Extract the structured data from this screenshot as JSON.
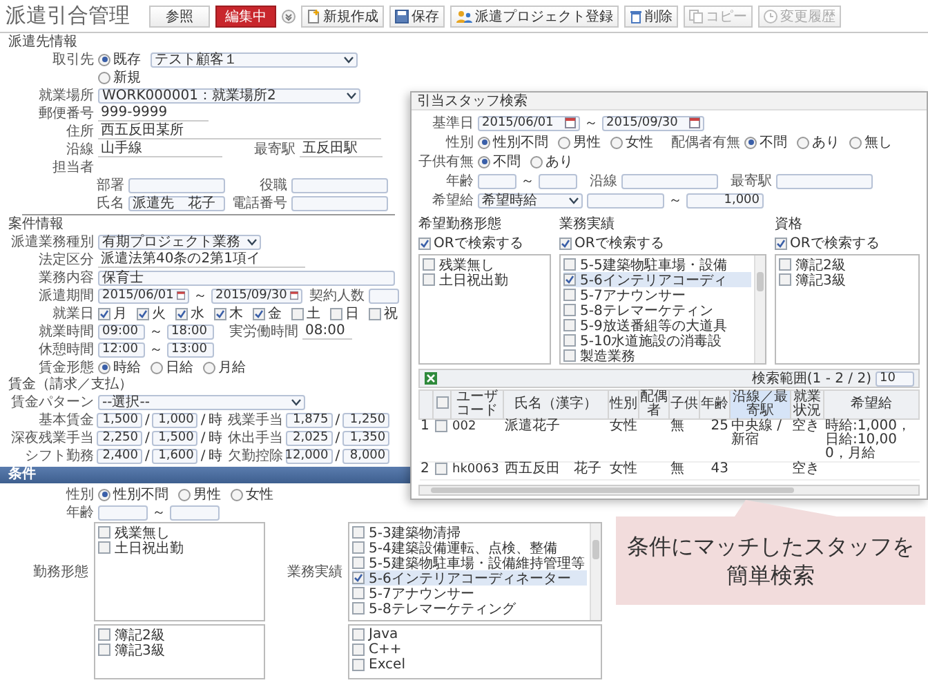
{
  "app_title": "派遣引合管理",
  "mode_tabs": [
    {
      "label": "参照",
      "selected": false
    },
    {
      "label": "編集中",
      "selected": true
    }
  ],
  "toolbar": [
    {
      "label": "新規作成",
      "kind": "new",
      "disabled": false
    },
    {
      "label": "保存",
      "kind": "save",
      "disabled": false
    },
    {
      "label": "派遣プロジェクト登録",
      "kind": "project",
      "disabled": false
    },
    {
      "label": "削除",
      "kind": "delete",
      "disabled": false
    },
    {
      "label": "コピー",
      "kind": "copy",
      "disabled": true
    },
    {
      "label": "変更履歴",
      "kind": "history",
      "disabled": true
    }
  ],
  "client_info": {
    "title": "派遣先情報",
    "client": {
      "label": "取引先",
      "options": [
        {
          "label": "既存",
          "selected": true
        },
        {
          "label": "新規",
          "selected": false
        }
      ],
      "value": "テスト顧客１"
    },
    "workplace": {
      "label": "就業場所",
      "value": "WORK000001：就業場所2"
    },
    "postal_code": {
      "label": "郵便番号",
      "value": "999-9999"
    },
    "address": {
      "label": "住所",
      "value": "西五反田某所"
    },
    "line": {
      "label": "沿線",
      "value": "山手線"
    },
    "station": {
      "label": "最寄駅",
      "value": "五反田駅"
    },
    "contact": {
      "label": "担当者",
      "department": {
        "label": "部署"
      },
      "position": {
        "label": "役職"
      },
      "name": {
        "label": "氏名",
        "value": "派遣先　花子"
      },
      "phone": {
        "label": "電話番号"
      }
    }
  },
  "project_info": {
    "title": "案件情報",
    "work_type": {
      "label": "派遣業務種別",
      "value": "有期プロジェクト業務"
    },
    "legal_category": {
      "label": "法定区分",
      "value": "派遣法第40条の2第1項イ"
    },
    "description": {
      "label": "業務内容",
      "value": "保育士"
    },
    "period": {
      "label": "派遣期間",
      "from": "2015/06/01",
      "tilde": "～",
      "to": "2015/09/30"
    },
    "headcount": {
      "label": "契約人数"
    },
    "workdays": {
      "label": "就業日",
      "days": [
        {
          "label": "月",
          "checked": true
        },
        {
          "label": "火",
          "checked": true
        },
        {
          "label": "水",
          "checked": true
        },
        {
          "label": "木",
          "checked": true
        },
        {
          "label": "金",
          "checked": true
        },
        {
          "label": "土",
          "checked": false
        },
        {
          "label": "日",
          "checked": false
        },
        {
          "label": "祝",
          "checked": false
        }
      ]
    },
    "work_hours": {
      "label": "就業時間",
      "from": "09:00",
      "tilde": "～",
      "to": "18:00"
    },
    "actual_hours": {
      "label": "実労働時間",
      "value": "08:00"
    },
    "break_hours": {
      "label": "休憩時間",
      "from": "12:00",
      "tilde": "～",
      "to": "13:00"
    },
    "wage_type": {
      "label": "賃金形態",
      "options": [
        {
          "label": "時給",
          "selected": true
        },
        {
          "label": "日給",
          "selected": false
        },
        {
          "label": "月給",
          "selected": false
        }
      ]
    }
  },
  "wages": {
    "title": "賃金（請求／支払）",
    "pattern": {
      "label": "賃金パターン",
      "value": "--選択--"
    },
    "rows": [
      {
        "label": "基本賃金",
        "bill": "1,500",
        "slash": "/",
        "pay": "1,000",
        "slash_2": "/",
        "unit": "時",
        "label_2": "残業手当",
        "bill_2": "1,875",
        "slash_3": "/",
        "pay_2": "1,250"
      },
      {
        "label": "深夜残業手当",
        "bill": "2,250",
        "slash": "/",
        "pay": "1,500",
        "slash_2": "/",
        "unit": "時",
        "label_2": "休出手当",
        "bill_2": "2,025",
        "slash_3": "/",
        "pay_2": "1,350"
      },
      {
        "label": "シフト勤務",
        "bill": "2,400",
        "slash": "/",
        "pay": "1,600",
        "slash_2": "/",
        "unit": "時",
        "label_2": "欠勤控除",
        "bill_2": "12,000",
        "slash_3": "/",
        "pay_2": "8,000"
      }
    ]
  },
  "conditions": {
    "title": "条件",
    "gender": {
      "label": "性別",
      "options": [
        {
          "label": "性別不問",
          "selected": true
        },
        {
          "label": "男性",
          "selected": false
        },
        {
          "label": "女性",
          "selected": false
        }
      ]
    },
    "age": {
      "label": "年齢",
      "tilde": "～"
    },
    "work_style": {
      "label": "勤務形態",
      "items": [
        {
          "label": "残業無し",
          "checked": false
        },
        {
          "label": "土日祝出勤",
          "checked": false
        }
      ]
    },
    "experience": {
      "label": "業務実績",
      "items": [
        {
          "label": "5-3建築物清掃",
          "checked": false
        },
        {
          "label": "5-4建築設備運転、点検、整備",
          "checked": false
        },
        {
          "label": "5-5建築物駐車場・設備維持管理等",
          "checked": false
        },
        {
          "label": "5-6インテリアコーディネーター",
          "checked": true
        },
        {
          "label": "5-7アナウンサー",
          "checked": false
        },
        {
          "label": "5-8テレマーケティング",
          "checked": false
        }
      ]
    },
    "qualifications": {
      "items": [
        {
          "label": "簿記2級",
          "checked": false
        },
        {
          "label": "簿記3級",
          "checked": false
        }
      ]
    },
    "skills": {
      "items": [
        {
          "label": "Java",
          "checked": false
        },
        {
          "label": "C++",
          "checked": false
        },
        {
          "label": "Excel",
          "checked": false
        }
      ]
    }
  },
  "staff_search": {
    "title": "引当スタッフ検索",
    "base_date": {
      "label": "基準日",
      "from": "2015/06/01",
      "tilde": "～",
      "to": "2015/09/30"
    },
    "gender": {
      "label": "性別",
      "options": [
        {
          "label": "性別不問",
          "selected": true
        },
        {
          "label": "男性",
          "selected": false
        },
        {
          "label": "女性",
          "selected": false
        }
      ]
    },
    "spouse": {
      "label": "配偶者有無",
      "options": [
        {
          "label": "不問",
          "selected": true
        },
        {
          "label": "あり",
          "selected": false
        },
        {
          "label": "無し",
          "selected": false
        }
      ]
    },
    "children": {
      "label": "子供有無",
      "options": [
        {
          "label": "不問",
          "selected": true
        },
        {
          "label": "あり",
          "selected": false
        }
      ]
    },
    "age": {
      "label": "年齢",
      "tilde": "～"
    },
    "line": {
      "label": "沿線"
    },
    "station": {
      "label": "最寄駅"
    },
    "salary": {
      "label": "希望給",
      "type": "希望時給",
      "tilde": "～",
      "to": "1,000"
    },
    "filters": [
      {
        "label": "希望勤務形態",
        "or_label": "ORで検索する",
        "or_checked": true,
        "scroll": false,
        "items": [
          {
            "label": "残業無し",
            "checked": false
          },
          {
            "label": "土日祝出勤",
            "checked": false
          }
        ]
      },
      {
        "label": "業務実績",
        "or_label": "ORで検索する",
        "or_checked": true,
        "scroll": true,
        "items": [
          {
            "label": "5-5建築物駐車場・設備",
            "checked": false
          },
          {
            "label": "5-6インテリアコーディ",
            "checked": true
          },
          {
            "label": "5-7アナウンサー",
            "checked": false
          },
          {
            "label": "5-8テレマーケティン",
            "checked": false
          },
          {
            "label": "5-9放送番組等の大道具",
            "checked": false
          },
          {
            "label": "5-10水道施設の消毒設",
            "checked": false
          },
          {
            "label": "製造業務",
            "checked": false
          }
        ]
      },
      {
        "label": "資格",
        "or_label": "ORで検索する",
        "or_checked": true,
        "scroll": false,
        "items": [
          {
            "label": "簿記2級",
            "checked": false
          },
          {
            "label": "簿記3級",
            "checked": false
          }
        ]
      }
    ],
    "results": {
      "range": "検索範囲(1 - 2 / 2)",
      "page_size": "10",
      "select_all_checked": false,
      "columns": [
        {
          "label": "ユーザコード",
          "selected": false
        },
        {
          "label": "氏名（漢字）",
          "selected": false
        },
        {
          "label": "性別",
          "selected": false
        },
        {
          "label": "配偶者",
          "selected": false
        },
        {
          "label": "子供",
          "selected": false
        },
        {
          "label": "年齢",
          "selected": false
        },
        {
          "label": "沿線／最寄駅",
          "selected": true
        },
        {
          "label": "就業状況",
          "selected": false
        },
        {
          "label": "希望給",
          "selected": false
        }
      ],
      "rows": [
        {
          "number": "1",
          "checked": false,
          "cells": [
            "002",
            "派遣花子",
            "女性",
            null,
            "無",
            "25",
            "中央線 / 新宿",
            "空き",
            "時給:1,000，日給:10,000，月給"
          ]
        },
        {
          "number": "2",
          "checked": false,
          "cells": [
            "hk0063",
            "西五反田　花子",
            "女性",
            null,
            "無",
            "43",
            null,
            "空き",
            null
          ]
        }
      ]
    }
  },
  "callout": {
    "lines": [
      "条件にマッチしたスタッフを",
      "簡単検索"
    ]
  }
}
